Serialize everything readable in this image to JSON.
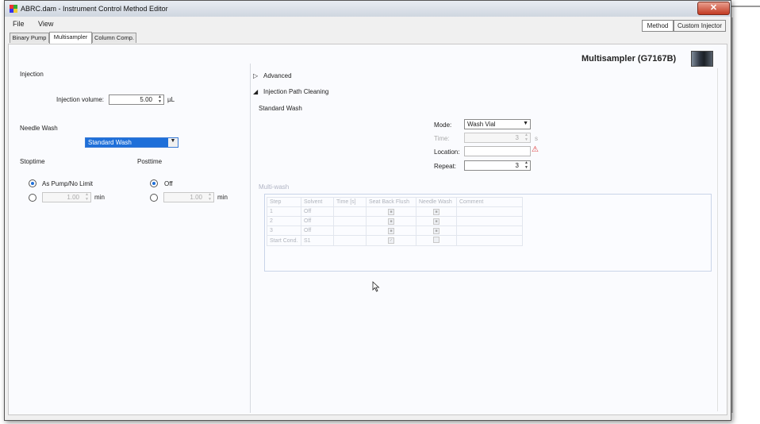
{
  "window": {
    "title": "ABRC.dam - Instrument Control Method Editor",
    "close_glyph": "✕"
  },
  "menu": [
    "File",
    "View"
  ],
  "top_buttons": {
    "method": "Method",
    "custom_injector": "Custom Injector"
  },
  "tabs": [
    {
      "label": "Binary Pump",
      "active": false
    },
    {
      "label": "Multisampler",
      "active": true
    },
    {
      "label": "Column Comp.",
      "active": false
    }
  ],
  "header": {
    "title": "Multisampler (G7167B)"
  },
  "injection": {
    "section_label": "Injection",
    "volume_label": "Injection volume:",
    "volume_value": "5.00",
    "volume_unit": "µL"
  },
  "needle_wash": {
    "section_label": "Needle Wash",
    "selected": "Standard Wash"
  },
  "stoptime": {
    "section_label": "Stoptime",
    "option_as_pump": "As Pump/No Limit",
    "value": "1.00",
    "unit": "min"
  },
  "posttime": {
    "section_label": "Posttime",
    "option_off": "Off",
    "value": "1.00",
    "unit": "min"
  },
  "advanced": {
    "label": "Advanced",
    "expander_icon": "triangle-right-icon"
  },
  "injection_path_cleaning": {
    "label": "Injection Path Cleaning",
    "expander_icon": "triangle-down-icon",
    "standard_wash_label": "Standard Wash",
    "mode_label": "Mode:",
    "mode_value": "Wash Vial",
    "time_label": "Time:",
    "time_value": "3",
    "time_unit": "s",
    "location_label": "Location:",
    "location_value": "",
    "repeat_label": "Repeat:",
    "repeat_value": "3"
  },
  "multi_wash": {
    "label": "Multi-wash",
    "columns": [
      "Step",
      "Solvent",
      "Time [s]",
      "Seat Back Flush",
      "Needle Wash",
      "Comment"
    ],
    "rows": [
      {
        "step": "1",
        "solvent": "Off",
        "time": "",
        "seat": "checked",
        "needle": "checked",
        "comment": ""
      },
      {
        "step": "2",
        "solvent": "Off",
        "time": "",
        "seat": "checked",
        "needle": "checked",
        "comment": ""
      },
      {
        "step": "3",
        "solvent": "Off",
        "time": "",
        "seat": "checked",
        "needle": "checked",
        "comment": ""
      },
      {
        "step": "Start Cond.",
        "solvent": "S1",
        "time": "",
        "seat": "checkmark",
        "needle": "unchecked",
        "comment": ""
      }
    ]
  },
  "colors": {
    "accent": "#1e6fd9",
    "window_bg": "#f0f0f0",
    "content_bg": "#fafbfe",
    "close": "#c23a22",
    "warning": "#dd3333"
  }
}
